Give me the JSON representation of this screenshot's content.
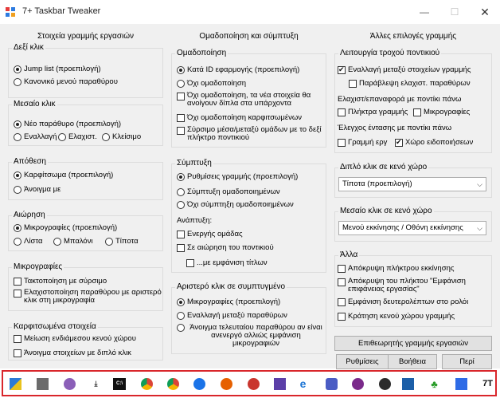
{
  "window": {
    "title": "7+ Taskbar Tweaker",
    "min_glyph": "—",
    "max_glyph": "☐",
    "close_glyph": "✕"
  },
  "left": {
    "title": "Στοιχεία γραμμής εργασιών",
    "right_click": {
      "title": "Δεξί κλικ",
      "options": [
        "Jump list (προεπιλογή)",
        "Κανονικό μενού παραθύρου"
      ]
    },
    "middle_click": {
      "title": "Μεσαίο κλικ",
      "options": [
        "Νέο παράθυρο (προεπιλογή)",
        "Εναλλαγή",
        "Ελαχιστ.",
        "Κλείσιμο"
      ]
    },
    "drop": {
      "title": "Απόθεση",
      "options": [
        "Καρφίτσωμα (προεπιλογή)",
        "Άνοιγμα με"
      ]
    },
    "hover": {
      "title": "Αιώρηση",
      "options": [
        "Μικρογραφίες (προεπιλογή)",
        "Λίστα",
        "Μπαλόνι",
        "Τίποτα"
      ]
    },
    "thumbnails": {
      "title": "Μικρογραφίες",
      "options": [
        "Τακτοποίηση με σύρσιμο",
        "Ελαχιστοποίηση παραθύρου με αριστερό κλικ στη μικρογραφία"
      ]
    },
    "pinned": {
      "title": "Καρφιτσωμένα στοιχεία",
      "options": [
        "Μείωση ενδιάμεσου κενού χώρου",
        "Άνοιγμα στοιχείων με διπλό κλικ"
      ]
    }
  },
  "middle": {
    "title": "Ομαδοποίηση και σύμπτυξη",
    "grouping": {
      "title": "Ομαδοποίηση",
      "radios": [
        "Κατά ID εφαρμογής (προεπιλογή)",
        "Όχι ομαδοποίηση"
      ],
      "checks": [
        "Όχι ομαδοποίηση, τα νέα στοιχεία θα ανοίγουν δίπλα στα υπάρχοντα",
        "Όχι ομαδοποίηση καρφιτσωμένων",
        "Σύρσιμο μέσα/μεταξύ ομάδων με το δεξί πλήκτρο ποντικιού"
      ]
    },
    "combine": {
      "title": "Σύμπτυξη",
      "radios": [
        "Ρυθμίσεις γραμμής (προεπιλογή)",
        "Σύμπτυξη ομαδοποιημένων",
        "Όχι σύμπτηξη ομαδοποιημένων"
      ],
      "expand_label": "Ανάπτυξη:",
      "checks": [
        "Ενεργής ομάδας",
        "Σε αιώρηση του ποντικιού",
        "...με εμφάνιση τίτλων"
      ]
    },
    "left_click": {
      "title": "Αριστερό κλικ σε συμπτυγμένο",
      "options": [
        "Μικρογραφίες (προεπιλογή)",
        "Εναλλαγή μεταξύ παραθύρων",
        "Άνοιγμα τελευταίου παραθύρου αν είναι ανενεργό αλλιώς εμφάνιση μικρογραφιών"
      ]
    }
  },
  "right": {
    "title": "Άλλες επιλογές γραμμής",
    "wheel": {
      "title": "Λειτουργία τροχού ποντικιού",
      "options": [
        "Εναλλαγή μεταξύ στοιχείων γραμμής",
        "Παράβλεψη ελαχιστ. παραθύρων"
      ],
      "minimize_label": "Ελαχιστ/επαναφορά με ποντίκι πάνω",
      "minimize_options": [
        "Πλήκτρα γραμμής",
        "Μικρογραφίες"
      ],
      "volume_label": "Έλεγχος έντασης με ποντίκι πάνω",
      "volume_options": [
        "Γραμμή εργ",
        "Χώρο ειδοποιήσεων"
      ]
    },
    "double_click": {
      "title": "Διπλό κλικ σε κενό χώρο",
      "value": "Τίποτα (προεπιλογή)"
    },
    "middle_empty": {
      "title": "Μεσαίο κλικ σε κενό χώρο",
      "value": "Μενού εκκίνησης / Οθόνη εκκίνησης"
    },
    "other": {
      "title": "Άλλα",
      "options": [
        "Απόκρυψη πλήκτρου εκκίνησης",
        "Απόκρυψη του πλήκτου \"Εμφάνιση επιφάνειας εργασίας\"",
        "Εμφάνιση δευτερολέπτων στο ρολόι",
        "Κράτηση κενού χώρου γραμμής"
      ]
    },
    "inspector_button": "Επιθεωρητής γραμμής εργασιών",
    "buttons": [
      "Ρυθμίσεις",
      "Βοήθεια",
      "Περί"
    ]
  },
  "taskbar": {
    "icons": [
      "7tt-app-icon",
      "taskbar-app-icon",
      "browser-icon",
      "download-icon",
      "terminal-icon",
      "chrome-icon",
      "chrome-icon-2",
      "sync-icon",
      "firefox-icon",
      "media-icon",
      "image-viewer-icon",
      "edge-icon",
      "settings-icon",
      "app-icon",
      "obs-icon",
      "window-icon",
      "clover-icon",
      "docs-icon",
      "chrome-icon-3",
      "7tt-tray-icon"
    ],
    "text_badges": [
      "C:\\",
      "7T"
    ]
  }
}
